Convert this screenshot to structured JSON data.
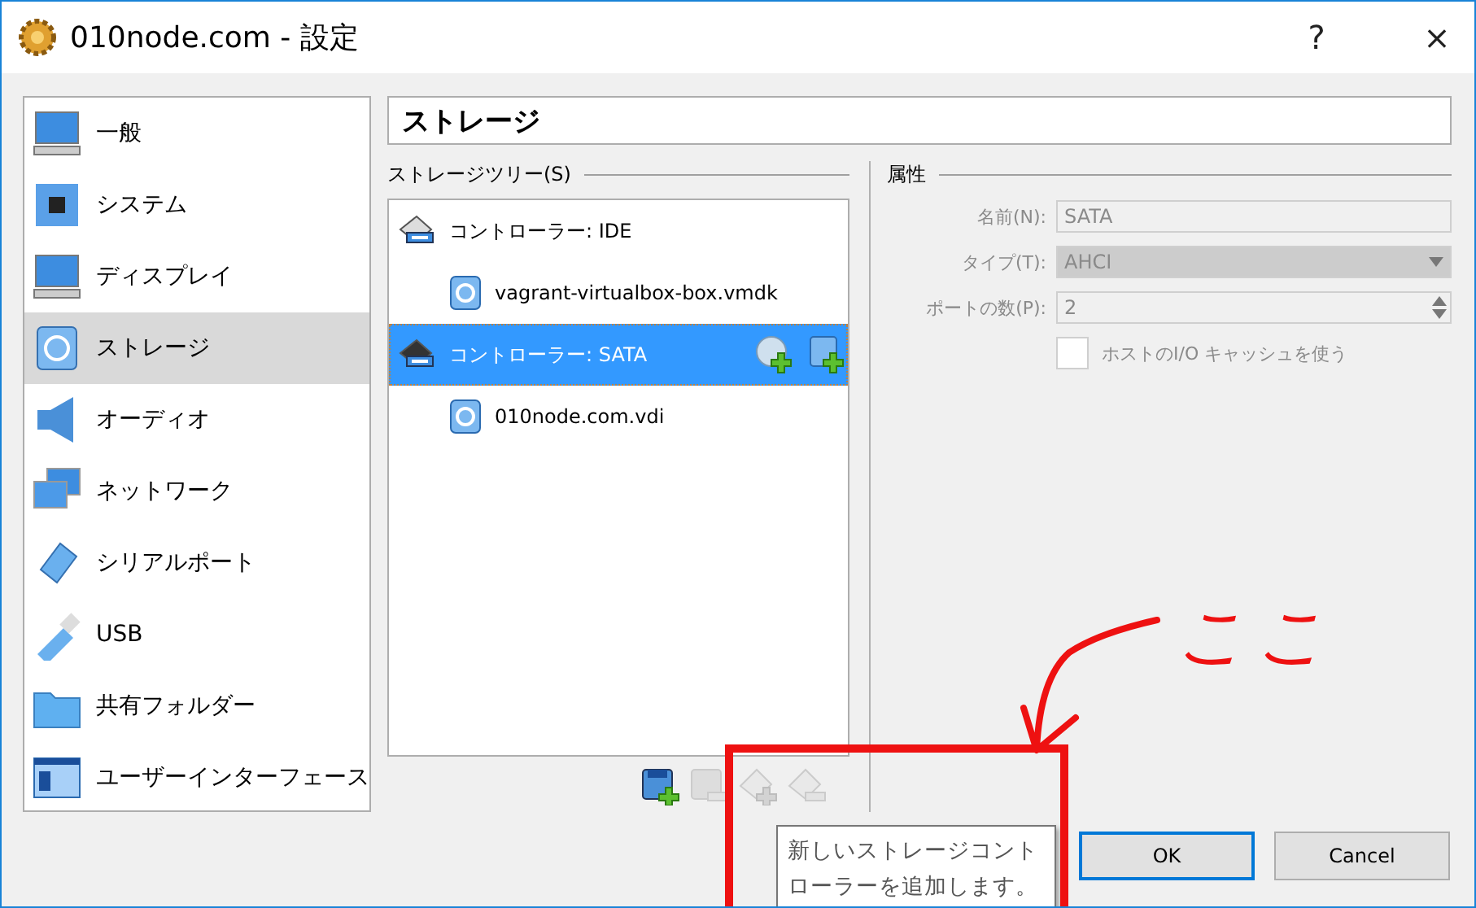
{
  "window": {
    "title": "010node.com - 設定",
    "help": "?",
    "close": "×"
  },
  "sidebar": {
    "items": [
      {
        "label": "一般",
        "selected": false
      },
      {
        "label": "システム",
        "selected": false
      },
      {
        "label": "ディスプレイ",
        "selected": false
      },
      {
        "label": "ストレージ",
        "selected": true
      },
      {
        "label": "オーディオ",
        "selected": false
      },
      {
        "label": "ネットワーク",
        "selected": false
      },
      {
        "label": "シリアルポート",
        "selected": false
      },
      {
        "label": "USB",
        "selected": false
      },
      {
        "label": "共有フォルダー",
        "selected": false
      },
      {
        "label": "ユーザーインターフェース",
        "selected": false
      }
    ]
  },
  "page_title": "ストレージ",
  "storage_tree": {
    "label": "ストレージツリー(S)",
    "items": [
      {
        "label": "コントローラー: IDE",
        "selected": false,
        "children": [
          {
            "label": "vagrant-virtualbox-box.vmdk"
          }
        ]
      },
      {
        "label": "コントローラー: SATA",
        "selected": true,
        "children": [
          {
            "label": "010node.com.vdi"
          }
        ]
      }
    ]
  },
  "toolbar": [
    {
      "kind": "add-controller",
      "disabled": false
    },
    {
      "kind": "remove-controller",
      "disabled": true
    },
    {
      "kind": "add-attachment",
      "disabled": true
    },
    {
      "kind": "remove-attachment",
      "disabled": true
    }
  ],
  "attributes": {
    "label": "属性",
    "disabled": true,
    "name_label": "名前(N):",
    "name_value": "SATA",
    "type_label": "タイプ(T):",
    "type_value": "AHCI",
    "ports_label": "ポートの数(P):",
    "ports_value": "2",
    "cache_label": "ホストのI/O キャッシュを使う",
    "cache_checked": false
  },
  "buttons": [
    {
      "label": "OK",
      "default": true
    },
    {
      "label": "Cancel",
      "default": false
    }
  ],
  "tooltip": "新しいストレージコントローラーを追加します。",
  "annotation": {
    "text": "ここ"
  }
}
